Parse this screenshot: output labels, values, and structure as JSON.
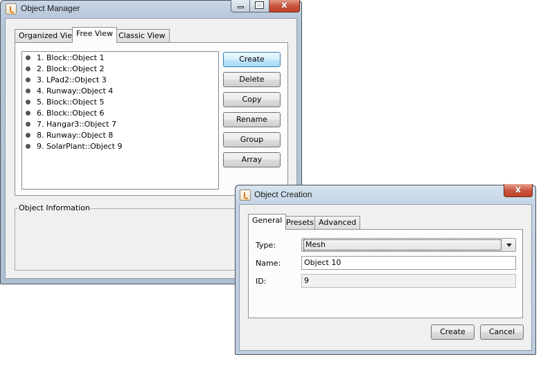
{
  "object_manager": {
    "title": "Object Manager",
    "tabs": [
      "Organized View",
      "Free View",
      "Classic View"
    ],
    "active_tab": "Free View",
    "objects": [
      "1. Block::Object 1",
      "2. Block::Object 2",
      "3. LPad2::Object 3",
      "4. Runway::Object 4",
      "5. Block::Object 5",
      "6. Block::Object 6",
      "7. Hangar3::Object 7",
      "8. Runway::Object 8",
      "9. SolarPlant::Object 9"
    ],
    "buttons": {
      "create": "Create",
      "delete": "Delete",
      "copy": "Copy",
      "rename": "Rename",
      "group": "Group",
      "array": "Array"
    },
    "info_group_title": "Object Information",
    "caption_close_glyph": "x"
  },
  "object_creation": {
    "title": "Object Creation",
    "tabs": [
      "General",
      "Presets",
      "Advanced"
    ],
    "active_tab": "General",
    "type_label": "Type:",
    "type_value": "Mesh",
    "name_label": "Name:",
    "name_value": "Object 10",
    "id_label": "ID:",
    "id_value": "9",
    "create_button": "Create",
    "cancel_button": "Cancel",
    "caption_close_glyph": "x"
  }
}
